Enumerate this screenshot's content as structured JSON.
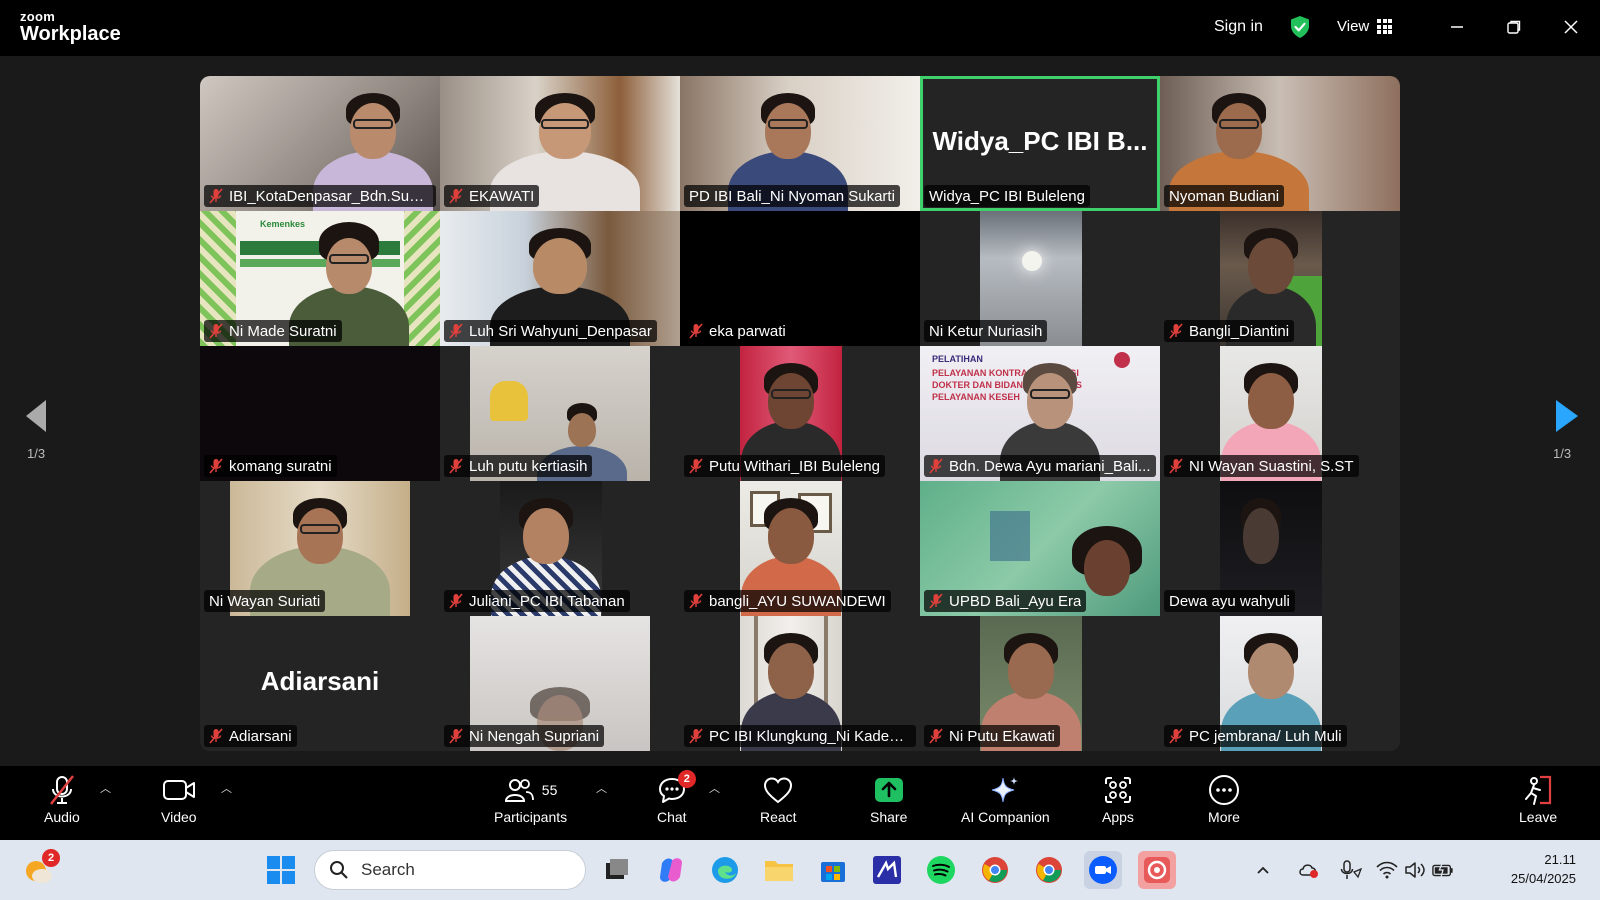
{
  "app": {
    "logo_small": "zoom",
    "logo_large": "Workplace"
  },
  "header": {
    "sign_in": "Sign in",
    "view": "View"
  },
  "pagination": {
    "left": "1/3",
    "right": "1/3"
  },
  "participants": [
    {
      "name": "IBI_KotaDenpasar_Bdn.Sumi...",
      "muted": true
    },
    {
      "name": "EKAWATI",
      "muted": true
    },
    {
      "name": "PD IBI Bali_Ni Nyoman Sukarti",
      "muted": false
    },
    {
      "name": "Widya_PC IBI Buleleng",
      "muted": false,
      "big": "Widya_PC IBI B...",
      "active": true
    },
    {
      "name": "Nyoman Budiani",
      "muted": false
    },
    {
      "name": "Ni Made Suratni",
      "muted": true
    },
    {
      "name": "Luh Sri Wahyuni_Denpasar",
      "muted": true
    },
    {
      "name": "eka parwati",
      "muted": true
    },
    {
      "name": "Ni Ketur Nuriasih",
      "muted": false
    },
    {
      "name": "Bangli_Diantini",
      "muted": true
    },
    {
      "name": "komang suratni",
      "muted": true
    },
    {
      "name": "Luh putu kertiasih",
      "muted": true
    },
    {
      "name": "Putu Withari_IBI Buleleng",
      "muted": true
    },
    {
      "name": "Bdn. Dewa Ayu mariani_Bali...",
      "muted": true
    },
    {
      "name": "NI Wayan Suastini, S.ST",
      "muted": true
    },
    {
      "name": "Ni Wayan Suriati",
      "muted": false
    },
    {
      "name": "Juliani_PC IBI Tabanan",
      "muted": true
    },
    {
      "name": "bangli_AYU SUWANDEWI",
      "muted": true
    },
    {
      "name": "UPBD Bali_Ayu Era",
      "muted": true
    },
    {
      "name": "Dewa ayu wahyuli",
      "muted": false
    },
    {
      "name": "Adiarsani",
      "muted": true,
      "big": "Adiarsani"
    },
    {
      "name": "Ni Nengah Supriani",
      "muted": true
    },
    {
      "name": "PC IBI Klungkung_Ni Kadek ...",
      "muted": true
    },
    {
      "name": "Ni Putu Ekawati",
      "muted": true
    },
    {
      "name": "PC jembrana/ Luh Muli",
      "muted": true
    }
  ],
  "slide_texts": {
    "pelatihan_title": "PELATIHAN",
    "pelatihan_line1": "PELAYANAN KONTRASEPSI BAGI",
    "pelatihan_line2": "DOKTER DAN BIDAN",
    "pelatihan_line2b": "ITAS",
    "pelatihan_line3": "PELAYANAN KESEH",
    "kemenkes": "Kemenkes"
  },
  "toolbar": {
    "audio": "Audio",
    "video": "Video",
    "participants": "Participants",
    "participants_count": "55",
    "chat": "Chat",
    "chat_badge": "2",
    "react": "React",
    "share": "Share",
    "ai_companion": "AI Companion",
    "apps": "Apps",
    "more": "More",
    "leave": "Leave"
  },
  "taskbar": {
    "weather_badge": "2",
    "search_placeholder": "Search",
    "time": "21.11",
    "date": "25/04/2025"
  },
  "colors": {
    "active_border": "#3fd06b",
    "share_green": "#1fc062",
    "badge_red": "#e02828",
    "leave_red": "#e04040"
  }
}
